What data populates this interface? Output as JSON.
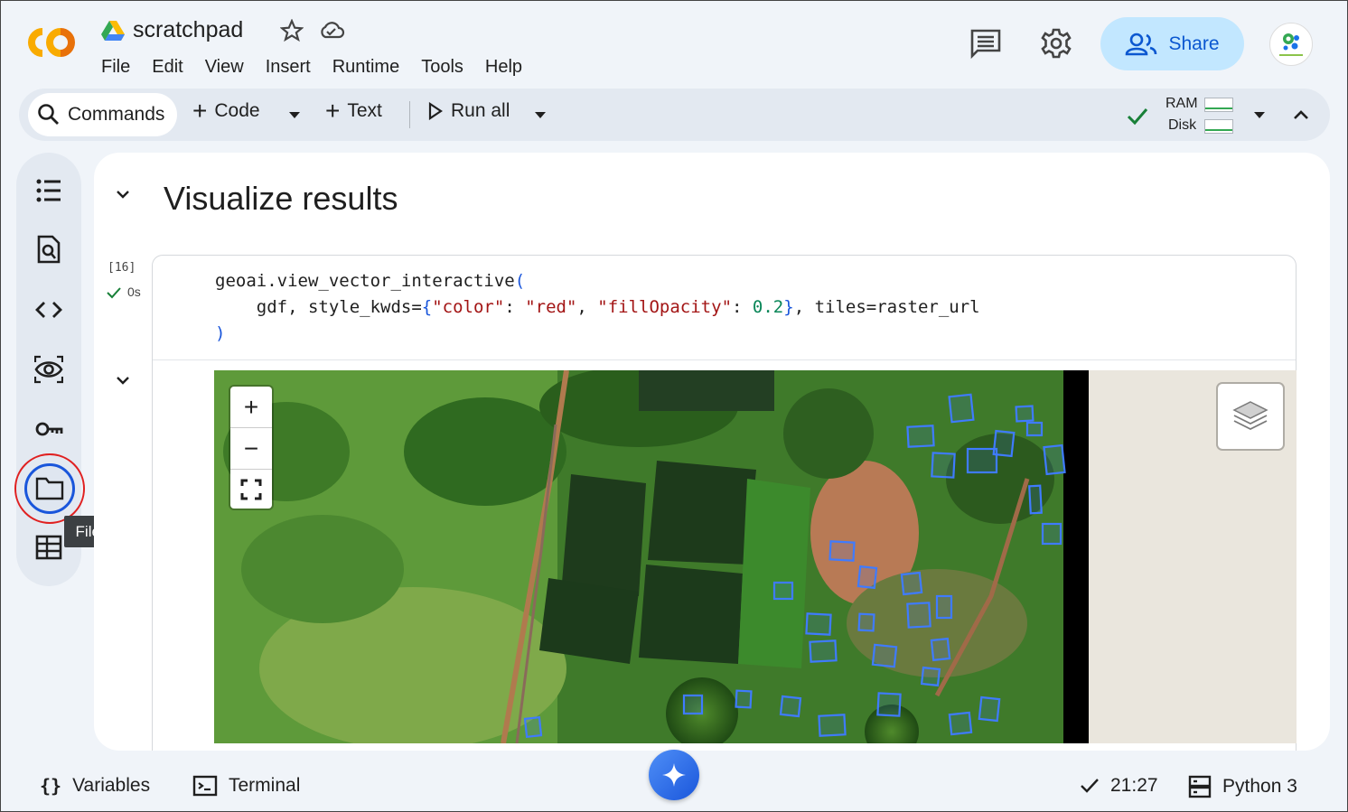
{
  "header": {
    "doc_title": "scratchpad",
    "menu": [
      "File",
      "Edit",
      "View",
      "Insert",
      "Runtime",
      "Tools",
      "Help"
    ],
    "share_label": "Share",
    "icons": [
      "colab-logo",
      "drive-icon",
      "star-icon",
      "cloud-icon",
      "comments-icon",
      "settings-icon",
      "share-people-icon",
      "avatar"
    ]
  },
  "toolbar": {
    "commands_label": "Commands",
    "code_label": "Code",
    "text_label": "Text",
    "run_all_label": "Run all",
    "ram_label": "RAM",
    "disk_label": "Disk",
    "status": "connected"
  },
  "left_rail": {
    "items": [
      "table-of-contents-icon",
      "find-replace-icon",
      "code-snippets-icon",
      "variable-inspector-icon",
      "secrets-key-icon",
      "files-folder-icon",
      "data-table-icon"
    ],
    "tooltip": "Files",
    "highlighted": "files-folder-icon"
  },
  "notebook": {
    "section_title": "Visualize results",
    "cell": {
      "exec_count": "[16]",
      "exec_time": "0s",
      "code_line1_fn": "geoai.view_vector_interactive",
      "code_line1_paren": "(",
      "code_line2_a": "    gdf, style_kwds=",
      "code_line2_open": "{",
      "code_line2_k1": "\"color\"",
      "code_line2_sep1": ": ",
      "code_line2_v1": "\"red\"",
      "code_line2_sep2": ", ",
      "code_line2_k2": "\"fillOpacity\"",
      "code_line2_sep3": ": ",
      "code_line2_v2": "0.2",
      "code_line2_close": "}",
      "code_line2_b": ", tiles=raster_url",
      "code_line3": ")"
    },
    "map": {
      "zoom_in": "+",
      "zoom_out": "−",
      "fullscreen": "fullscreen-icon",
      "layers": "layers-icon",
      "polygon_color": "#3f7bff"
    }
  },
  "bottombar": {
    "variables_label": "Variables",
    "terminal_label": "Terminal",
    "time": "21:27",
    "runtime_label": "Python 3"
  },
  "colors": {
    "accent": "#0b57d0",
    "share_bg": "#c2e7ff",
    "highlight_ring": "#e02020",
    "status_green": "#34a853"
  }
}
